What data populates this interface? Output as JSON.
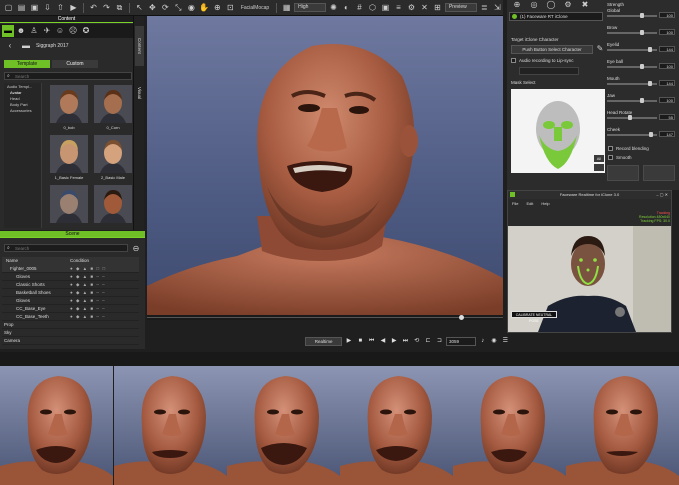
{
  "toolbar": {
    "facial_mocap_label": "FacialMocap",
    "quality": "High",
    "preview": "Preview"
  },
  "content": {
    "title": "Content",
    "side_tab_content": "Content",
    "side_tab_visual": "Visual",
    "breadcrumb": "Siggraph 2017",
    "tabs": [
      "Template",
      "Custom"
    ],
    "search_placeholder": "Search",
    "tree": [
      "Audio Templ...",
      "Avatar",
      "Head",
      "Body Part",
      "Accessories"
    ],
    "thumbs": [
      {
        "label": "0_bob",
        "skin": "#b07a5a",
        "hair": "#6a3a1c"
      },
      {
        "label": "0_Corn",
        "skin": "#a56e4e",
        "hair": "#5a3018"
      },
      {
        "label": "1_Basic Female",
        "skin": "#c89572",
        "hair": "#c8a060"
      },
      {
        "label": "2_Basic Male",
        "skin": "#d4a27d",
        "hair": "#7a5030"
      },
      {
        "label": "",
        "skin": "#9a8070",
        "hair": "#3a4a6a"
      },
      {
        "label": "",
        "skin": "#a05a3a",
        "hair": "#2a1a10"
      }
    ]
  },
  "scene": {
    "title": "Scene",
    "search_placeholder": "Search",
    "col_name": "Name",
    "col_condition": "Condition",
    "rows": [
      {
        "name": "Fighter_0005",
        "cond": "● ◆ ▲ ■ □ □"
      },
      {
        "name": "Gloves",
        "cond": "● ◆ ▲ ■ – –"
      },
      {
        "name": "Classic Shorts",
        "cond": "● ◆ ▲ ■ – –"
      },
      {
        "name": "Basketball Shoes",
        "cond": "● ◆ ▲ ■ – –"
      },
      {
        "name": "Gloves",
        "cond": "● ◆ ▲ ■ – –"
      },
      {
        "name": "CC_Base_Eye",
        "cond": "● ◆ ▲ ■ – –"
      },
      {
        "name": "CC_Base_Teeth",
        "cond": "● ◆ ▲ ■ – –"
      },
      {
        "name": "Prop",
        "cond": ""
      },
      {
        "name": "Sky",
        "cond": ""
      },
      {
        "name": "Camera",
        "cond": ""
      }
    ]
  },
  "timeline": {
    "mode": "Realtime",
    "frame": "3059"
  },
  "faceware": {
    "device": "(1) Faceware RT iClone",
    "target_label": "Target iClone Character",
    "pick_button": "Push Button Select Character",
    "audio_checkbox": "Audio recording to Lip-sync",
    "mask_label": "Mask Select",
    "strength_label": "Strength",
    "sliders": [
      {
        "label": "Global",
        "value": "100",
        "level": 0.72
      },
      {
        "label": "Brow",
        "value": "100",
        "level": 0.72
      },
      {
        "label": "Eyelid",
        "value": "144",
        "level": 0.9
      },
      {
        "label": "Eye ball",
        "value": "100",
        "level": 0.72
      },
      {
        "label": "Mouth",
        "value": "144",
        "level": 0.9
      },
      {
        "label": "Jaw",
        "value": "100",
        "level": 0.72
      },
      {
        "label": "Head Rotate",
        "value": "55",
        "level": 0.45
      },
      {
        "label": "Cheek",
        "value": "147",
        "level": 0.92
      }
    ],
    "check_blending": "Record blending",
    "check_smooth": "Smooth",
    "all_button": "All"
  },
  "webcam": {
    "title": "Faceware Realtime for iClone 3.0",
    "menu": [
      "File",
      "Edit",
      "Help"
    ],
    "status_lines": [
      "Tracking",
      "Resolution 480x640",
      "Tracking FPS: 30.0"
    ],
    "calibrate_button": "CALIBRATE NEUTRAL POSE"
  },
  "colors": {
    "accent_green": "#6fbf26",
    "viewport_top": "#5a6a96",
    "viewport_bottom": "#3f4c72",
    "skin": "#b4644a"
  }
}
